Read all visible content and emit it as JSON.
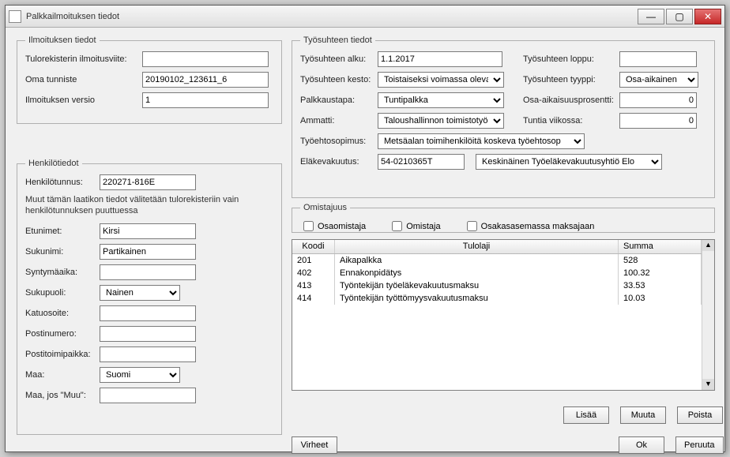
{
  "window": {
    "title": "Palkkailmoituksen tiedot"
  },
  "ilm": {
    "legend": "Ilmoituksen tiedot",
    "ref_label": "Tulorekisterin ilmoitusviite:",
    "ref": "",
    "own_label": "Oma tunniste",
    "own": "20190102_123611_6",
    "ver_label": "Ilmoituksen versio",
    "ver": "1"
  },
  "henk": {
    "legend": "Henkilötiedot",
    "ssn_label": "Henkilötunnus:",
    "ssn": "220271-816E",
    "note": "Muut tämän laatikon tiedot välitetään tulorekisteriin vain henkilötunnuksen puuttuessa",
    "first_label": "Etunimet:",
    "first": "Kirsi",
    "last_label": "Sukunimi:",
    "last": "Partikainen",
    "dob_label": "Syntymäaika:",
    "dob": "",
    "sex_label": "Sukupuoli:",
    "sex": "Nainen",
    "street_label": "Katuosoite:",
    "street": "",
    "zip_label": "Postinumero:",
    "zip": "",
    "city_label": "Postitoimipaikka:",
    "city": "",
    "country_label": "Maa:",
    "country": "Suomi",
    "country_other_label": "Maa, jos \"Muu\":",
    "country_other": ""
  },
  "tyo": {
    "legend": "Työsuhteen tiedot",
    "start_label": "Työsuhteen alku:",
    "start": "1.1.2017",
    "end_label": "Työsuhteen loppu:",
    "end": "",
    "dur_label": "Työsuhteen kesto:",
    "dur": "Toistaiseksi voimassa oleva",
    "type_label": "Työsuhteen tyyppi:",
    "type": "Osa-aikainen",
    "pay_label": "Palkkaustapa:",
    "pay": "Tuntipalkka",
    "part_label": "Osa-aikaisuusprosentti:",
    "part": "0",
    "job_label": "Ammatti:",
    "job": "Taloushallinnon toimistotyöntekijät",
    "hw_label": "Tuntia viikossa:",
    "hw": "0",
    "cao_label": "Työehtosopimus:",
    "cao": "Metsäalan toimihenkilöitä koskeva työehtosop",
    "pens_label": "Eläkevakuutus:",
    "pens_num": "54-0210365T",
    "pens_co": "Keskinäinen Työeläkevakuutusyhtiö Elo"
  },
  "omi": {
    "legend": "Omistajuus",
    "coowner": "Osaomistaja",
    "owner": "Omistaja",
    "shareholder": "Osakasasemassa maksajaan"
  },
  "table": {
    "h_code": "Koodi",
    "h_type": "Tulolaji",
    "h_sum": "Summa",
    "rows": [
      {
        "code": "201",
        "type": "Aikapalkka",
        "sum": "528"
      },
      {
        "code": "402",
        "type": "Ennakonpidätys",
        "sum": "100.32"
      },
      {
        "code": "413",
        "type": "Työntekijän työeläkevakuutusmaksu",
        "sum": "33.53"
      },
      {
        "code": "414",
        "type": "Työntekijän työttömyysvakuutusmaksu",
        "sum": "10.03"
      }
    ]
  },
  "buttons": {
    "add": "Lisää",
    "edit": "Muuta",
    "del": "Poista",
    "errors": "Virheet",
    "ok": "Ok",
    "cancel": "Peruuta"
  },
  "chart_data": {
    "type": "table",
    "columns": [
      "Koodi",
      "Tulolaji",
      "Summa"
    ],
    "rows": [
      [
        "201",
        "Aikapalkka",
        528
      ],
      [
        "402",
        "Ennakonpidätys",
        100.32
      ],
      [
        "413",
        "Työntekijän työeläkevakuutusmaksu",
        33.53
      ],
      [
        "414",
        "Työntekijän työttömyysvakuutusmaksu",
        10.03
      ]
    ]
  }
}
